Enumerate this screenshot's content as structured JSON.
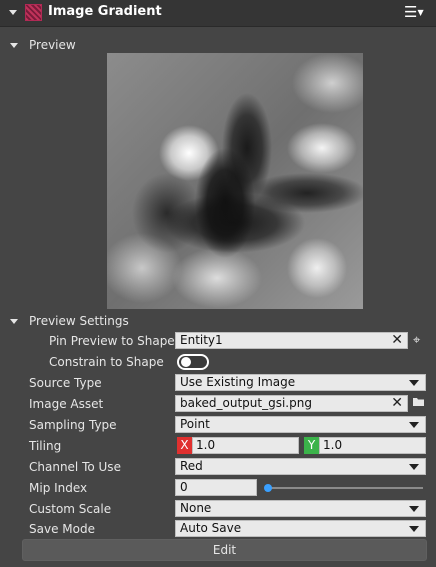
{
  "window": {
    "title": "Image Gradient",
    "menu_icon": "hamburger-menu-icon"
  },
  "preview": {
    "section_label": "Preview",
    "image": "grayscale-gradient-noise-preview"
  },
  "preview_settings": {
    "section_label": "Preview Settings",
    "pin_preview": {
      "label": "Pin Preview to Shape",
      "value": "Entity1"
    },
    "constrain": {
      "label": "Constrain to Shape",
      "enabled": false
    }
  },
  "properties": {
    "source_type": {
      "label": "Source Type",
      "value": "Use Existing Image"
    },
    "image_asset": {
      "label": "Image Asset",
      "value": "baked_output_gsi.png"
    },
    "sampling_type": {
      "label": "Sampling Type",
      "value": "Point"
    },
    "tiling": {
      "label": "Tiling",
      "x_label": "X",
      "x_value": "1.0",
      "y_label": "Y",
      "y_value": "1.0"
    },
    "channel": {
      "label": "Channel To Use",
      "value": "Red"
    },
    "mip_index": {
      "label": "Mip Index",
      "value": "0",
      "slider_fraction": 0
    },
    "custom_scale": {
      "label": "Custom Scale",
      "value": "None"
    },
    "save_mode": {
      "label": "Save Mode",
      "value": "Auto Save"
    }
  },
  "actions": {
    "edit_label": "Edit"
  },
  "colors": {
    "panel_bg": "#454545",
    "x_axis": "#e0302f",
    "y_axis": "#3bb34a",
    "slider_accent": "#2d8cf0",
    "gradient_icon": "#c0325a"
  }
}
